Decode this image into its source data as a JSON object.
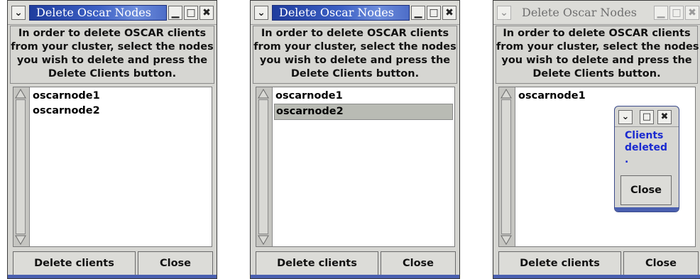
{
  "windows": [
    {
      "title": "Delete Oscar Nodes",
      "instructions": [
        "In order to delete OSCAR clients",
        "from your cluster, select the nodes",
        "you wish to delete and press the",
        "Delete Clients button."
      ],
      "items": [
        {
          "label": "oscarnode1",
          "selected": false
        },
        {
          "label": "oscarnode2",
          "selected": false
        }
      ],
      "delete_label": "Delete clients",
      "close_label": "Close"
    },
    {
      "title": "Delete Oscar Nodes",
      "instructions": [
        "In order to delete OSCAR clients",
        "from your cluster, select the nodes",
        "you wish to delete and press the",
        "Delete Clients button."
      ],
      "items": [
        {
          "label": "oscarnode1",
          "selected": false
        },
        {
          "label": "oscarnode2",
          "selected": true
        }
      ],
      "delete_label": "Delete clients",
      "close_label": "Close"
    },
    {
      "title": "Delete Oscar Nodes",
      "instructions": [
        "In order to delete OSCAR clients",
        "from your cluster, select the nodes",
        "you wish to delete and press the",
        "Delete Clients button."
      ],
      "items": [
        {
          "label": "oscarnode1",
          "selected": false
        }
      ],
      "delete_label": "Delete clients",
      "close_label": "Close"
    }
  ],
  "popup": {
    "message": [
      "Clients",
      "deleted",
      "."
    ],
    "close_label": "Close"
  },
  "icons": {
    "menu": "chevron-down-icon",
    "minimize": "minimize-icon",
    "maximize": "maximize-icon",
    "close": "close-icon"
  },
  "colors": {
    "title_active": "#2d4fb8",
    "window_bg": "#d6d6d2",
    "selection": "#b9bbb4",
    "popup_text": "#1a2ad0"
  }
}
